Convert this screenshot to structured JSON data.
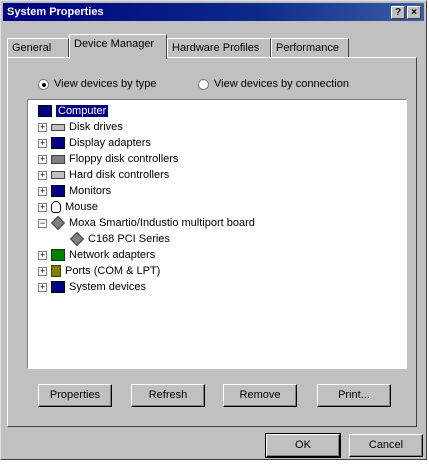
{
  "window": {
    "title": "System Properties",
    "help_button": "?",
    "close_button": "×"
  },
  "tabs": [
    {
      "label": "General",
      "active": false
    },
    {
      "label": "Device Manager",
      "active": true
    },
    {
      "label": "Hardware Profiles",
      "active": false
    },
    {
      "label": "Performance",
      "active": false
    }
  ],
  "view_options": {
    "by_type": {
      "label": "View devices by type",
      "selected": true
    },
    "by_connection": {
      "label": "View devices by connection",
      "selected": false
    }
  },
  "device_tree": [
    {
      "label": "Computer",
      "icon": "computer-icon",
      "expander": "",
      "selected": true
    },
    {
      "label": "Disk drives",
      "icon": "disk-drive-icon",
      "expander": "+"
    },
    {
      "label": "Display adapters",
      "icon": "display-adapter-icon",
      "expander": "+"
    },
    {
      "label": "Floppy disk controllers",
      "icon": "floppy-controller-icon",
      "expander": "+"
    },
    {
      "label": "Hard disk controllers",
      "icon": "hard-disk-controller-icon",
      "expander": "+"
    },
    {
      "label": "Monitors",
      "icon": "monitor-icon",
      "expander": "+"
    },
    {
      "label": "Mouse",
      "icon": "mouse-icon",
      "expander": "+"
    },
    {
      "label": "Moxa Smartio/Industio multiport board",
      "icon": "multiport-board-icon",
      "expander": "−"
    },
    {
      "label": "C168 PCI Series",
      "icon": "multiport-board-icon",
      "expander": ""
    },
    {
      "label": "Network adapters",
      "icon": "network-adapter-icon",
      "expander": "+"
    },
    {
      "label": "Ports (COM & LPT)",
      "icon": "ports-icon",
      "expander": "+"
    },
    {
      "label": "System devices",
      "icon": "system-devices-icon",
      "expander": "+"
    }
  ],
  "action_buttons": {
    "properties": "Properties",
    "refresh": "Refresh",
    "remove": "Remove",
    "print": "Print..."
  },
  "dialog_buttons": {
    "ok": "OK",
    "cancel": "Cancel"
  }
}
